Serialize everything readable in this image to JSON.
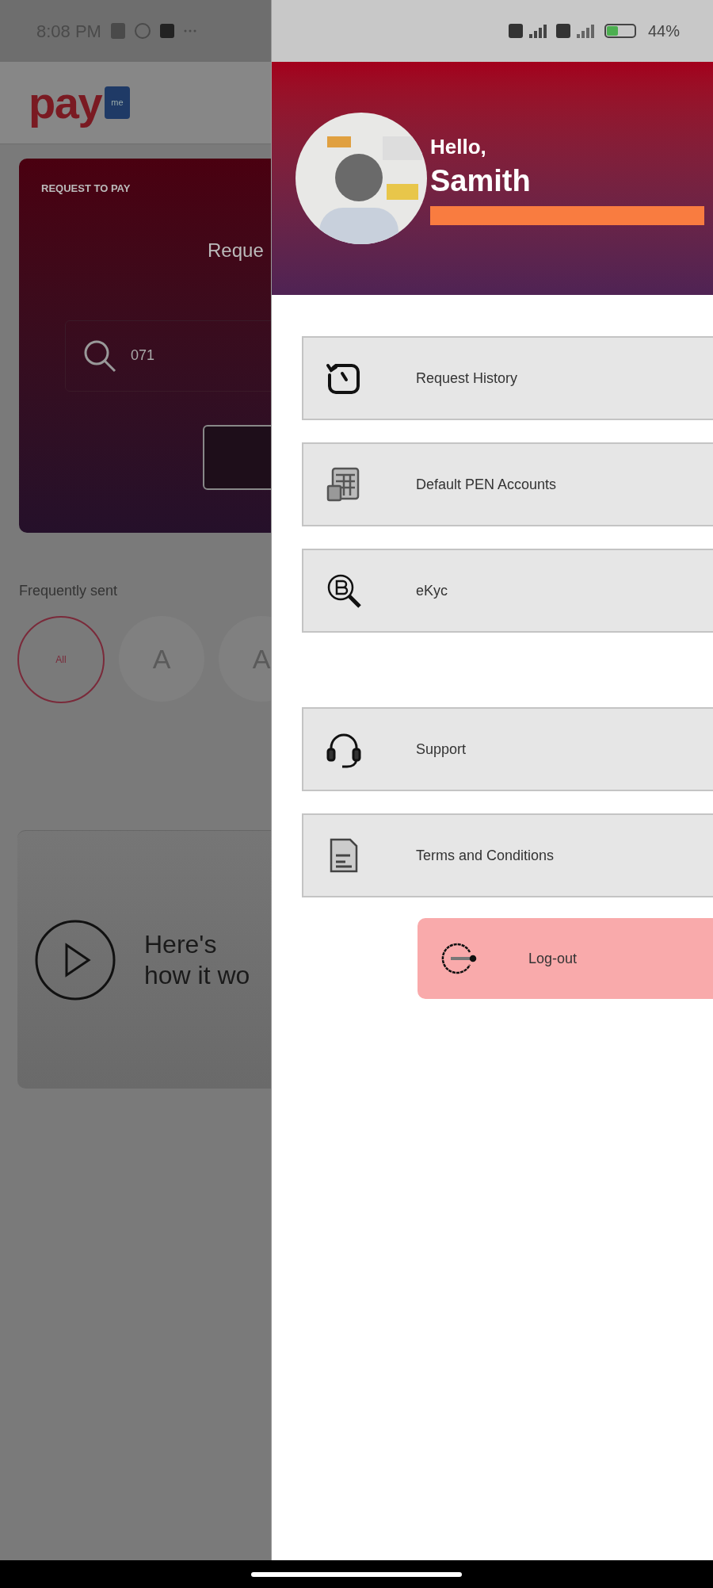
{
  "background_screen": {
    "status_bar": {
      "time": "8:08 PM"
    },
    "logo": {
      "text": "pay",
      "badge": "me"
    },
    "request_card": {
      "label": "REQUEST TO PAY",
      "title": "Reque",
      "search": {
        "value": "071"
      }
    },
    "frequently_sent": {
      "title": "Frequently sent",
      "contacts": [
        {
          "label": "All",
          "selected": true
        },
        {
          "label": "A",
          "selected": false
        },
        {
          "label": "A",
          "selected": false
        }
      ]
    },
    "video_card": {
      "title": "Here's how it wo"
    }
  },
  "drawer": {
    "status_bar": {
      "battery": "44%"
    },
    "greeting": "Hello,",
    "name": "Samith",
    "menu_groups": [
      [
        {
          "label": "Request History"
        },
        {
          "label": "Default PEN Accounts"
        },
        {
          "label": "eKyc"
        }
      ],
      [
        {
          "label": "Support"
        },
        {
          "label": "Terms and Conditions"
        }
      ]
    ],
    "logout": "Log-out"
  }
}
